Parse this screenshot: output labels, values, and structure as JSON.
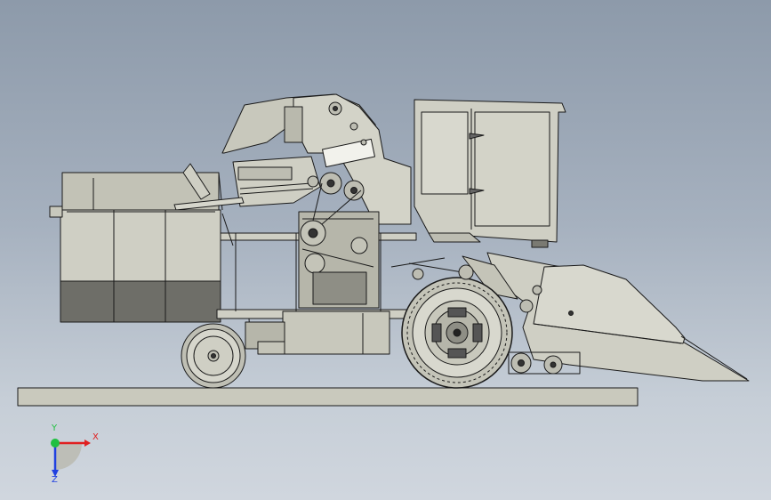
{
  "viewport": {
    "background_top": "#8d9aaa",
    "background_bottom": "#d0d6de",
    "model_fill": "#c8c8bc",
    "model_dark": "#6e6e68",
    "line_color": "#1a1a1a"
  },
  "triad": {
    "x_label": "X",
    "y_label": "Y",
    "z_label": "Z",
    "x_color": "#e02020",
    "y_color": "#20c040",
    "z_color": "#2040e0"
  }
}
